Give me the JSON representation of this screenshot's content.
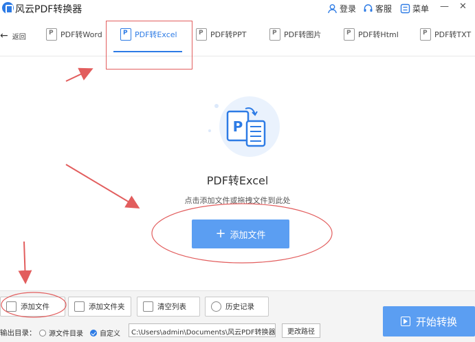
{
  "app": {
    "title": "风云PDF转换器"
  },
  "titlebar": {
    "login": "登录",
    "service": "客服",
    "menu": "菜单"
  },
  "tabbar": {
    "back_label": "返回",
    "tabs": [
      {
        "label": "PDF转Word",
        "active": false
      },
      {
        "label": "PDF转Excel",
        "active": true
      },
      {
        "label": "PDF转PPT",
        "active": false
      },
      {
        "label": "PDF转图片",
        "active": false
      },
      {
        "label": "PDF转Html",
        "active": false
      },
      {
        "label": "PDF转TXT",
        "active": false
      }
    ]
  },
  "main": {
    "title": "PDF转Excel",
    "hint": "点击添加文件或拖拽文件到此处",
    "add_button": "添加文件",
    "illustration_letter": "P"
  },
  "bottom": {
    "add_file": "添加文件",
    "add_folder": "添加文件夹",
    "clear_list": "清空列表",
    "history": "历史记录",
    "output_label": "输出目录：",
    "opt_source": "源文件目录",
    "opt_custom": "自定义",
    "selected_option": "自定义",
    "output_path": "C:\\Users\\admin\\Documents\\风云PDF转换器\\",
    "change_path": "更改路径",
    "start": "开始转换"
  },
  "colors": {
    "accent": "#2d7be5",
    "button": "#5b9ef2",
    "annotation": "#e25d5d"
  }
}
